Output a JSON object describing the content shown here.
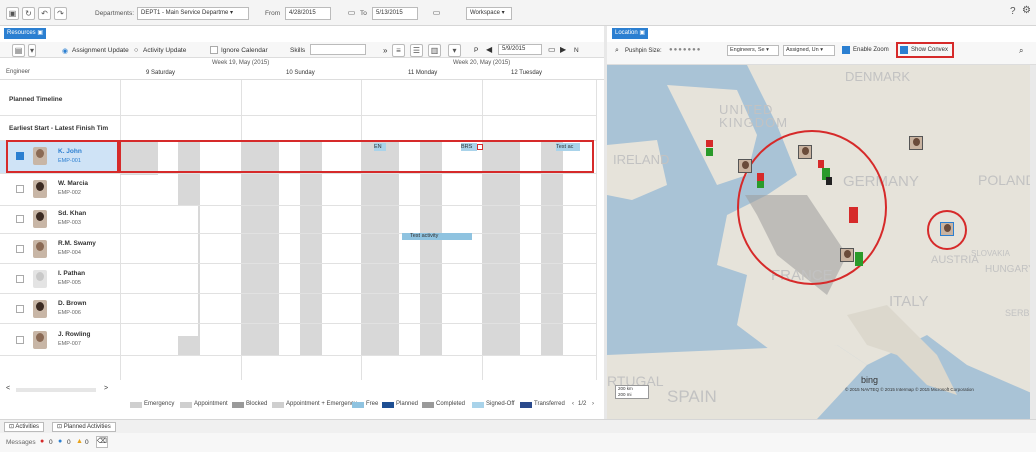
{
  "topbar": {
    "departments_label": "Departments:",
    "departments_value": "DEPT1 - Main Service Departme",
    "from_label": "From",
    "from_value": "4/28/2015",
    "to_label": "To",
    "to_value": "5/13/2015",
    "workspace_label": "Workspace",
    "help": "?",
    "settings": "⚙"
  },
  "resources": {
    "tab_label": "Resources",
    "assignment_update": "Assignment Update",
    "activity_update": "Activity Update",
    "ignore_calendar": "Ignore Calendar",
    "skills_label": "Skills",
    "date_value": "5/9/2015",
    "nav_p": "P",
    "nav_n": "N",
    "engineer_header": "Engineer",
    "week19": "Week 19, May (2015)",
    "week20": "Week 20, May (2015)",
    "days": [
      "9 Saturday",
      "10 Sunday",
      "11 Monday",
      "12 Tuesday"
    ],
    "planned_timeline": "Planned Timeline",
    "earliest_start": "Earliest Start - Latest Finish Tim",
    "engineers": [
      {
        "name": "K. John",
        "id": "EMP-001"
      },
      {
        "name": "W. Marcia",
        "id": "EMP-002"
      },
      {
        "name": "Sd. Khan",
        "id": "EMP-003"
      },
      {
        "name": "R.M. Swamy",
        "id": "EMP-004"
      },
      {
        "name": "I. Pathan",
        "id": "EMP-005"
      },
      {
        "name": "D. Brown",
        "id": "EMP-006"
      },
      {
        "name": "J. Rowling",
        "id": "EMP-007"
      }
    ],
    "bars": {
      "en": "EN",
      "brs": "BRS",
      "test_ac": "Test ac",
      "test_activity": "Test activity"
    }
  },
  "legend": {
    "items": [
      {
        "label": "Emergency",
        "color": "#cfcfcf"
      },
      {
        "label": "Appointment",
        "color": "#cfcfcf"
      },
      {
        "label": "Blocked",
        "color": "#9a9a9a"
      },
      {
        "label": "Appointment + Emergency",
        "color": "#cfcfcf"
      },
      {
        "label": "Free",
        "color": "#8fc3e0"
      },
      {
        "label": "Planned",
        "color": "#1e4f93"
      },
      {
        "label": "Completed",
        "color": "#9a9a9a"
      },
      {
        "label": "Signed-Off",
        "color": "#a9d3ea"
      },
      {
        "label": "Transferred",
        "color": "#2a4a8c"
      }
    ],
    "pager": "1/2"
  },
  "location": {
    "tab_label": "Location",
    "pushpin_label": "Pushpin Size:",
    "engineers_select": "Engineers, Se",
    "assigned_select": "Assigned, Un",
    "enable_zoom": "Enable Zoom",
    "show_convex": "Show Convex",
    "map_labels": {
      "united_kingdom": "UNITED KINGDOM",
      "ireland": "IRELAND",
      "denmark": "DENMARK",
      "germany": "GERMANY",
      "poland": "POLAND",
      "france": "FRANCE",
      "italy": "ITALY",
      "spain": "SPAIN",
      "portugal": "RTUGAL",
      "austria": "AUSTRIA",
      "hungary": "HUNGARY",
      "slovakia": "SLOVAKIA",
      "serbia": "SERBIA",
      "bing": "bing",
      "copyright": "© 2015 NAVTEQ © 2015 Intermap © 2015 Microsoft Corporation",
      "scale_top": "200 km",
      "scale_bottom": "200 mi"
    }
  },
  "bottom": {
    "activities_tab": "Activities",
    "planned_activities_tab": "Planned Activities",
    "messages_label": "Messages",
    "count_red": "0",
    "count_blue": "0",
    "count_warn": "0"
  }
}
